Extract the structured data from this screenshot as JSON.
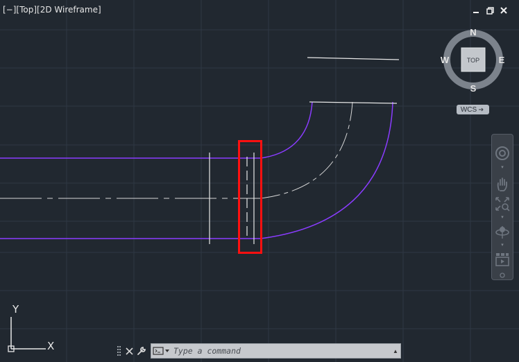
{
  "viewport": {
    "label": "[−][Top][2D Wireframe]"
  },
  "window_controls": {
    "minimize_icon": "minimize-icon",
    "restore_icon": "restore-icon",
    "close_icon": "close-icon"
  },
  "viewcube": {
    "face": "TOP",
    "north": "N",
    "south": "S",
    "east": "E",
    "west": "W"
  },
  "wcs_menu": {
    "label": "WCS"
  },
  "navbar": {
    "items": [
      "steering-wheel-icon",
      "pan-icon",
      "zoom-extents-icon",
      "orbit-icon",
      "showmotion-icon"
    ]
  },
  "ucs_icon": {
    "y_label": "Y",
    "x_label": "X"
  },
  "command_line": {
    "placeholder": "Type a command"
  },
  "colors": {
    "background": "#212830",
    "grid": "#2e3844",
    "pipe_edges": "#8a3cff",
    "linework": "#ffffff",
    "selection_box": "#ff1010"
  }
}
